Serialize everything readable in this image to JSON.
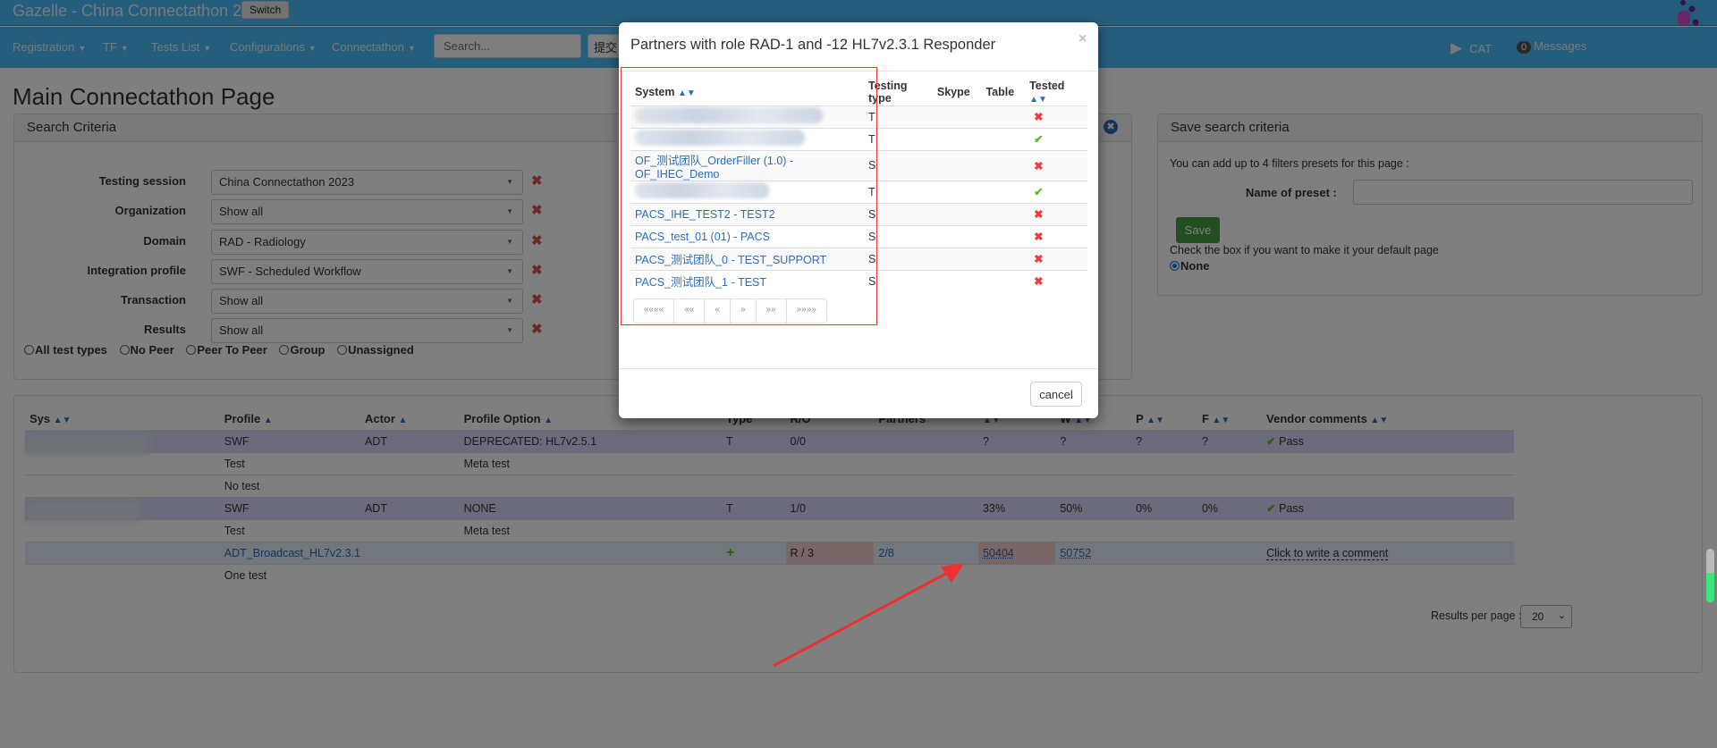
{
  "header": {
    "app_title": "Gazelle - China Connectathon 2023",
    "switch_label": "Switch"
  },
  "nav": {
    "items": [
      "Registration",
      "TF",
      "Tests List",
      "Configurations",
      "Connectathon"
    ],
    "search_placeholder": "Search...",
    "submit_label": "提交",
    "cat_label": "CAT",
    "messages_count": "0",
    "messages_label": "Messages"
  },
  "page_title": "Main Connectathon Page",
  "search_criteria": {
    "title": "Search Criteria",
    "filters": [
      {
        "label": "Testing session",
        "value": "China Connectathon 2023"
      },
      {
        "label": "Organization",
        "value": "Show all"
      },
      {
        "label": "Domain",
        "value": "RAD - Radiology"
      },
      {
        "label": "Integration profile",
        "value": "SWF - Scheduled Workflow"
      },
      {
        "label": "Transaction",
        "value": "Show all"
      },
      {
        "label": "Results",
        "value": "Show all"
      }
    ],
    "test_types": [
      "All test types",
      "No Peer",
      "Peer To Peer",
      "Group",
      "Unassigned"
    ]
  },
  "save_criteria": {
    "title": "Save search criteria",
    "intro": "You can add up to 4 filters presets for this page :",
    "preset_label": "Name of preset :",
    "preset_value": "",
    "save_label": "Save",
    "default_text": "Check the box if you want to make it your default page",
    "default_option": "None"
  },
  "results": {
    "columns": [
      "Sys",
      "Profile",
      "Actor",
      "Profile Option",
      "Type",
      "R/O",
      "Partners",
      "",
      "W",
      "P",
      "F",
      "Vendor comments"
    ],
    "rows": [
      {
        "style": "purple",
        "cells": [
          "",
          "SWF",
          "ADT",
          "DEPRECATED: HL7v2.5.1",
          "T",
          "0/0",
          "",
          "?",
          "?",
          "?",
          "?",
          "Pass"
        ]
      },
      {
        "style": "",
        "cells": [
          "",
          "Test",
          "",
          "Meta test",
          "",
          "",
          "",
          "",
          "",
          "",
          "",
          ""
        ]
      },
      {
        "style": "",
        "cells": [
          "",
          "No test",
          "",
          "",
          "",
          "",
          "",
          "",
          "",
          "",
          "",
          ""
        ]
      },
      {
        "style": "purple",
        "cells": [
          "",
          "SWF",
          "ADT",
          "NONE",
          "T",
          "1/0",
          "",
          "33%",
          "50%",
          "0%",
          "0%",
          "Pass"
        ]
      },
      {
        "style": "",
        "cells": [
          "",
          "Test",
          "",
          "Meta test",
          "",
          "",
          "",
          "",
          "",
          "",
          "",
          ""
        ]
      },
      {
        "style": "blue",
        "cells": [
          "",
          "ADT_Broadcast_HL7v2.3.1",
          "",
          "",
          "+",
          "R / 3",
          "2/8",
          "50404",
          "50752",
          "",
          "",
          "Click to write a comment"
        ]
      },
      {
        "style": "",
        "cells": [
          "",
          "One test",
          "",
          "",
          "",
          "",
          "",
          "",
          "",
          "",
          "",
          ""
        ]
      }
    ],
    "per_page_label": "Results per page :",
    "per_page_value": "20"
  },
  "modal": {
    "title": "Partners with role RAD-1 and -12 HL7v2.3.1 Responder",
    "close": "×",
    "columns": [
      "System",
      "Testing type",
      "Skype",
      "Table",
      "Tested"
    ],
    "rows": [
      {
        "system": "",
        "type": "T",
        "tested": "no"
      },
      {
        "system": "",
        "type": "T",
        "tested": "yes"
      },
      {
        "system": "OF_测试团队_OrderFiller (1.0) - OF_IHEC_Demo",
        "type": "S",
        "tested": "no"
      },
      {
        "system": "",
        "type": "T",
        "tested": "yes"
      },
      {
        "system": "PACS_IHE_TEST2 - TEST2",
        "type": "S",
        "tested": "no"
      },
      {
        "system": "PACS_test_01 (01) - PACS",
        "type": "S",
        "tested": "no"
      },
      {
        "system": "PACS_测试团队_0 - TEST_SUPPORT",
        "type": "S",
        "tested": "no"
      },
      {
        "system": "PACS_测试团队_1 - TEST",
        "type": "S",
        "tested": "no"
      }
    ],
    "pager": [
      "««««",
      "««",
      "«",
      "»",
      "»»",
      "»»»»"
    ],
    "cancel_label": "cancel"
  },
  "scroll_progress": 0.55,
  "colors": {
    "accent": "#2a6db5",
    "header": "#4bbcfb",
    "save": "#449d44",
    "cross": "#ee3b3b",
    "check": "#5cb82c"
  }
}
